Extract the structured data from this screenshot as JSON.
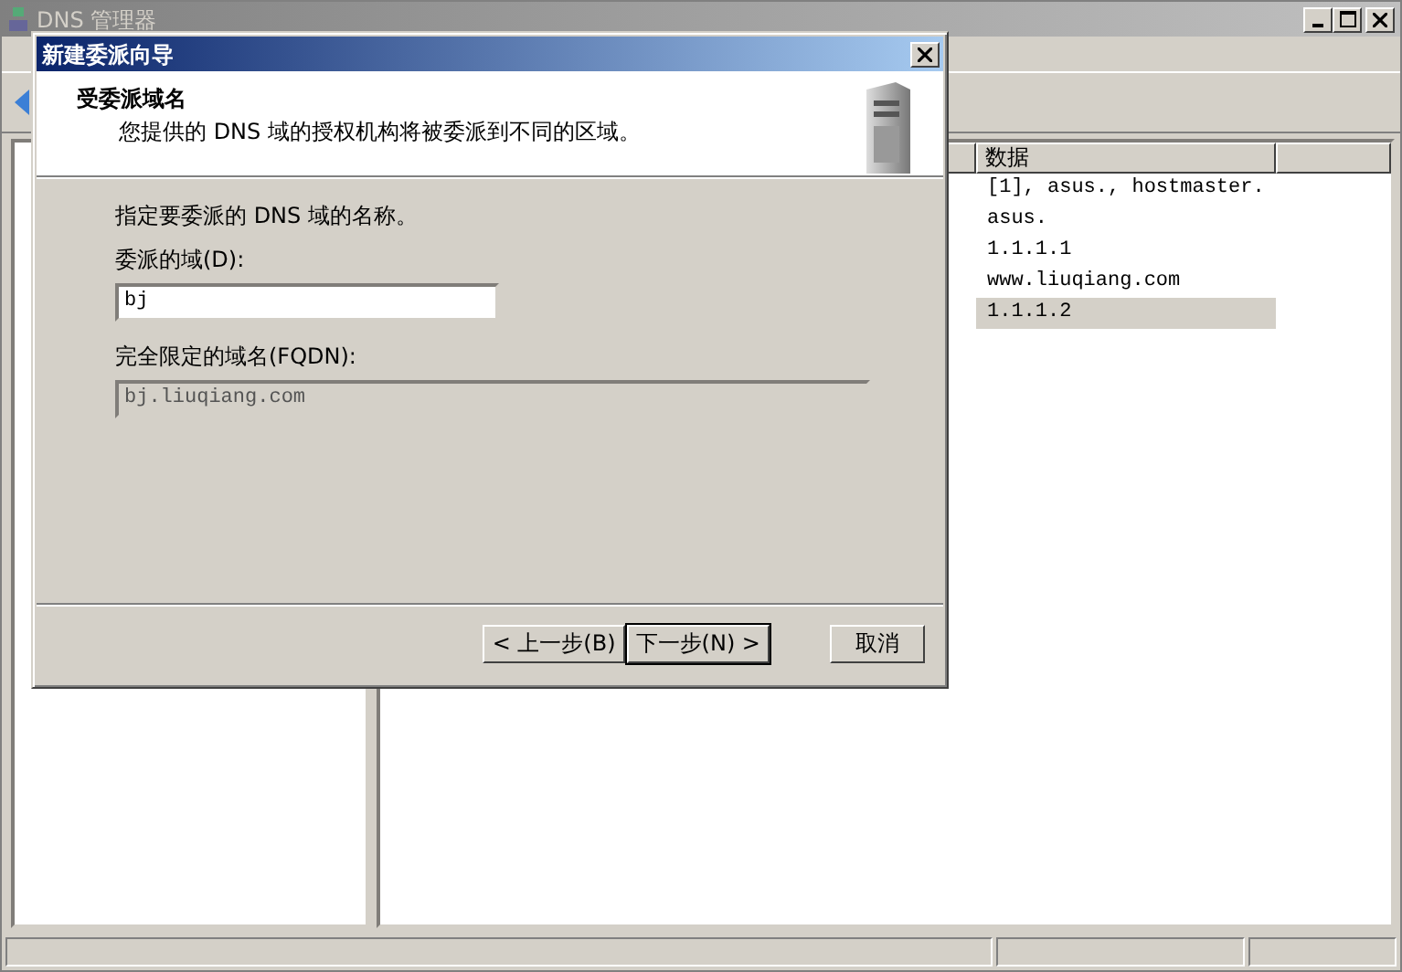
{
  "main_window": {
    "title": "DNS 管理器",
    "list": {
      "columns": [
        "数据"
      ],
      "rows": [
        {
          "data": "[1], asus., hostmaster.",
          "selected": false
        },
        {
          "data": "asus.",
          "selected": false
        },
        {
          "data": "1.1.1.1",
          "selected": false
        },
        {
          "data": "www.liuqiang.com",
          "selected": false
        },
        {
          "data": "1.1.1.2",
          "selected": true
        }
      ]
    }
  },
  "dialog": {
    "title": "新建委派向导",
    "header": {
      "title": "受委派域名",
      "subtitle": "您提供的 DNS 域的授权机构将被委派到不同的区域。"
    },
    "instruction": "指定要委派的 DNS 域的名称。",
    "fields": [
      {
        "label": "委派的域(D):",
        "value": "bj",
        "disabled": false
      },
      {
        "label": "完全限定的域名(FQDN):",
        "value": "bj.liuqiang.com",
        "disabled": true
      }
    ],
    "buttons": [
      {
        "label": "< 上一步(B)",
        "default": false
      },
      {
        "label": "下一步(N) >",
        "default": true
      },
      {
        "label": "取消",
        "default": false
      }
    ]
  }
}
